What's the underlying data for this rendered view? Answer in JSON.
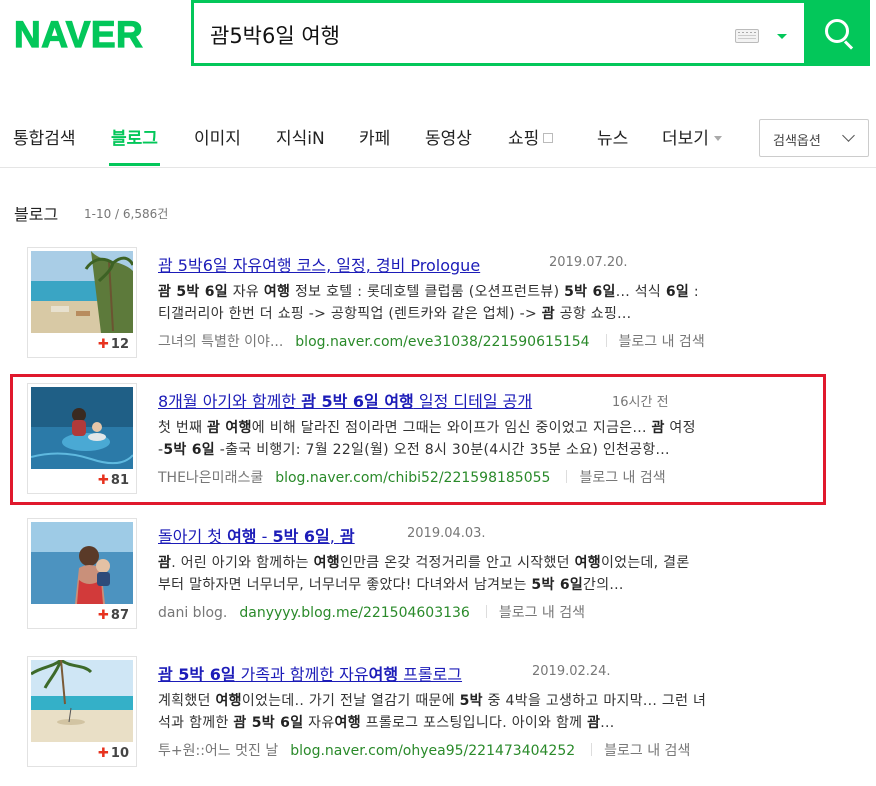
{
  "logo": "NAVER",
  "search": {
    "query": "괌5박6일 여행"
  },
  "tabs": [
    "통합검색",
    "블로그",
    "이미지",
    "지식iN",
    "카페",
    "동영상",
    "쇼핑",
    "뉴스",
    "더보기"
  ],
  "active_tab": "블로그",
  "search_options": "검색옵션",
  "section": {
    "title": "블로그",
    "count": "1-10 / 6,586건"
  },
  "colors": {
    "brand": "#03c75a",
    "link": "#1c1cb8",
    "url": "#2a8a2a",
    "highlight": "#e0182d",
    "like": "#e7321e"
  },
  "results": [
    {
      "title_parts": [
        "괌 5박6일 자유여행 코스, 일정, 경비 Prologue"
      ],
      "date": "2019.07.20.",
      "desc_lines": [
        [
          "괌 5박 6일",
          " 자유 ",
          "여행",
          " 정보 호텔 : 롯데호텔 클럽룸 (오션프런트뷰) ",
          "5박 6일",
          "... 석식 ",
          "6일",
          " :"
        ],
        [
          "티갤러리아 한번 더 쇼핑 -> 공항픽업 (렌트카와 같은 업체) -> ",
          "괌",
          " 공항 쇼핑..."
        ]
      ],
      "blogger": "그녀의 특별한 이야...",
      "url": "blog.naver.com/eve31038/221590615154",
      "in_blog": "블로그 내 검색",
      "likes": "12"
    },
    {
      "title_parts": [
        "8개월 아기와 함께한 ",
        "괌 5박 6일 여행",
        " 일정 디테일 공개"
      ],
      "date": "16시간 전",
      "desc_lines": [
        [
          "첫 번째 ",
          "괌 여행",
          "에 비해 달라진 점이라면 그때는 와이프가 임신 중이었고 지금은... ",
          "괌",
          " 여정"
        ],
        [
          "-",
          "5박 6일",
          " -출국 비행기: 7월 22일(월) 오전 8시 30분(4시간 35분 소요) 인천공항..."
        ]
      ],
      "blogger": "THE나은미래스쿨",
      "url": "blog.naver.com/chibi52/221598185055",
      "in_blog": "블로그 내 검색",
      "likes": "81"
    },
    {
      "title_parts": [
        "돌아기 첫 ",
        "여행",
        " - ",
        "5박 6일",
        ", ",
        "괌"
      ],
      "date": "2019.04.03.",
      "desc_lines": [
        [
          "괌",
          ". 어린 아기와 함께하는 ",
          "여행",
          "인만큼 온갖 걱정거리를 안고 시작했던 ",
          "여행",
          "이었는데, 결론"
        ],
        [
          "부터 말하자면 너무너무, 너무너무 좋았다! 다녀와서 남겨보는 ",
          "5박 6일",
          "간의..."
        ]
      ],
      "blogger": "dani blog.",
      "url": "danyyyy.blog.me/221504603136",
      "in_blog": "블로그 내 검색",
      "likes": "87"
    },
    {
      "title_parts": [
        "괌 5박 6일",
        " 가족과 함께한 자유",
        "여행",
        " 프롤로그"
      ],
      "date": "2019.02.24.",
      "desc_lines": [
        [
          "계획했던 ",
          "여행",
          "이었는데.. 가기 전날 열감기 때문에 ",
          "5박",
          " 중 4박을 고생하고 마지막... 그런 녀"
        ],
        [
          "석과 함께한 ",
          "괌 5박 6일",
          " 자유",
          "여행",
          " 프롤로그 포스팅입니다. 아이와 함께 ",
          "괌",
          "..."
        ]
      ],
      "blogger": "투+원::어느 멋진 날",
      "url": "blog.naver.com/ohyea95/221473404252",
      "in_blog": "블로그 내 검색",
      "likes": "10"
    }
  ]
}
